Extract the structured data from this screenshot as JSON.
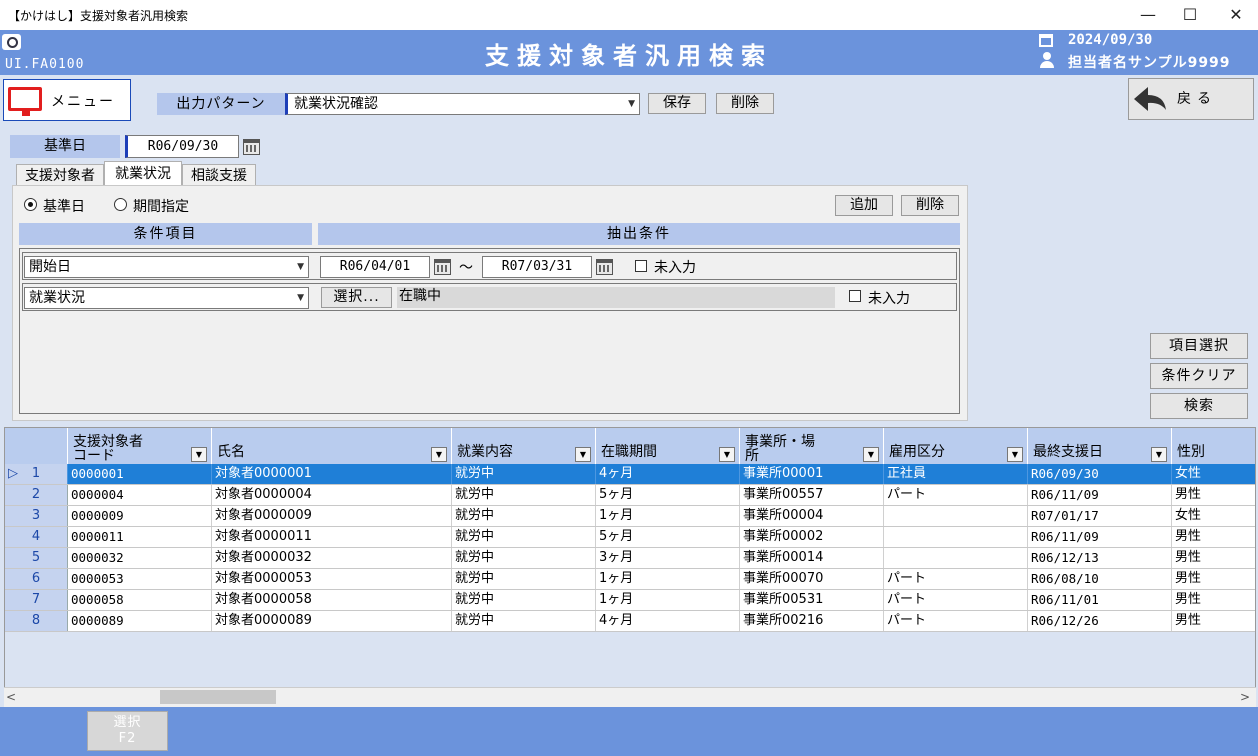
{
  "window": {
    "title": "【かけはし】支援対象者汎用検索",
    "minimize_glyph": "—",
    "maximize_glyph": "☐",
    "close_glyph": "✕"
  },
  "header": {
    "screen_id": "UI.FA0100",
    "title": "支援対象者汎用検索",
    "date": "2024/09/30",
    "user": "担当者名サンプル9999"
  },
  "toolbar": {
    "menu_label": "メニュー",
    "pattern_label": "出力パターン",
    "pattern_value": "就業状況確認",
    "save_label": "保存",
    "delete_label": "削除",
    "back_label": "戻る"
  },
  "base_date": {
    "label": "基準日",
    "value": "R06/09/30"
  },
  "tabs": [
    {
      "label": "支援対象者"
    },
    {
      "label": "就業状況"
    },
    {
      "label": "相談支援"
    }
  ],
  "conditions": {
    "radio_base_label": "基準日",
    "radio_period_label": "期間指定",
    "add_label": "追加",
    "delete_label": "削除",
    "col_item": "条件項目",
    "col_condition": "抽出条件",
    "rows": [
      {
        "item": "開始日",
        "from": "R06/04/01",
        "tilde": "～",
        "to": "R07/03/31",
        "empty_label": "未入力"
      },
      {
        "item": "就業状況",
        "choose_label": "選択...",
        "value": "在職中",
        "empty_label": "未入力"
      }
    ]
  },
  "side_buttons": {
    "item_select": "項目選択",
    "clear": "条件クリア",
    "search": "検索"
  },
  "grid": {
    "columns": [
      {
        "label": "支援対象者\nコード"
      },
      {
        "label": "氏名"
      },
      {
        "label": "就業内容"
      },
      {
        "label": "在職期間"
      },
      {
        "label": "事業所・場\n所"
      },
      {
        "label": "雇用区分"
      },
      {
        "label": "最終支援日"
      },
      {
        "label": "性別"
      }
    ],
    "selected_row_marker": "▷",
    "rows": [
      {
        "no": "1",
        "code": "0000001",
        "name": "対象者0000001",
        "work": "就労中",
        "period": "4ヶ月",
        "office": "事業所00001",
        "emp": "正社員",
        "last": "R06/09/30",
        "sex": "女性"
      },
      {
        "no": "2",
        "code": "0000004",
        "name": "対象者0000004",
        "work": "就労中",
        "period": "5ヶ月",
        "office": "事業所00557",
        "emp": "パート",
        "last": "R06/11/09",
        "sex": "男性"
      },
      {
        "no": "3",
        "code": "0000009",
        "name": "対象者0000009",
        "work": "就労中",
        "period": "1ヶ月",
        "office": "事業所00004",
        "emp": "",
        "last": "R07/01/17",
        "sex": "女性"
      },
      {
        "no": "4",
        "code": "0000011",
        "name": "対象者0000011",
        "work": "就労中",
        "period": "5ヶ月",
        "office": "事業所00002",
        "emp": "",
        "last": "R06/11/09",
        "sex": "男性"
      },
      {
        "no": "5",
        "code": "0000032",
        "name": "対象者0000032",
        "work": "就労中",
        "period": "3ヶ月",
        "office": "事業所00014",
        "emp": "",
        "last": "R06/12/13",
        "sex": "男性"
      },
      {
        "no": "6",
        "code": "0000053",
        "name": "対象者0000053",
        "work": "就労中",
        "period": "1ヶ月",
        "office": "事業所00070",
        "emp": "パート",
        "last": "R06/08/10",
        "sex": "男性"
      },
      {
        "no": "7",
        "code": "0000058",
        "name": "対象者0000058",
        "work": "就労中",
        "period": "1ヶ月",
        "office": "事業所00531",
        "emp": "パート",
        "last": "R06/11/01",
        "sex": "男性"
      },
      {
        "no": "8",
        "code": "0000089",
        "name": "対象者0000089",
        "work": "就労中",
        "period": "4ヶ月",
        "office": "事業所00216",
        "emp": "パート",
        "last": "R06/12/26",
        "sex": "男性"
      }
    ]
  },
  "footer": {
    "select_label": "選択",
    "select_key": "F2"
  },
  "colors": {
    "header_blue": "#6b93dc",
    "selection_blue": "#1f7fd7",
    "label_blue": "#b4c6ec"
  },
  "icons": [
    "camera-icon",
    "calendar-icon",
    "user-icon",
    "monitor-icon",
    "back-arrow-icon",
    "dropdown-arrow-icon"
  ]
}
